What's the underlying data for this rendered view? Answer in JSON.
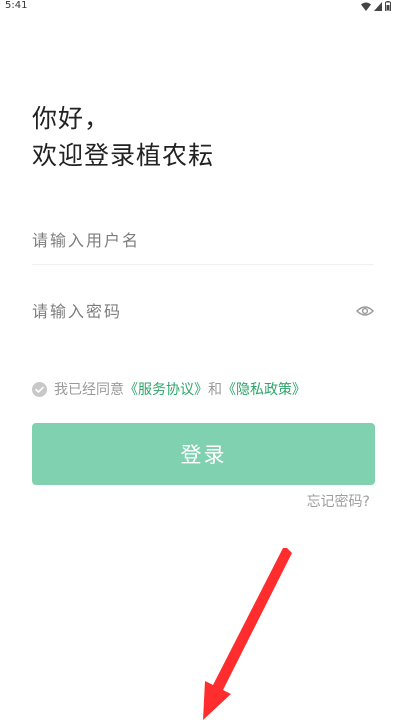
{
  "status_bar": {
    "time": "5:41",
    "icons": [
      "wifi-icon",
      "signal-icon",
      "battery-icon"
    ]
  },
  "greeting": {
    "line1": "你好，",
    "line2": "欢迎登录植农耘"
  },
  "login_form": {
    "username_placeholder": "请输入用户名",
    "username_value": "",
    "password_placeholder": "请输入密码",
    "password_value": "",
    "password_toggle_icon": "eye-icon"
  },
  "agreement": {
    "checked": false,
    "prefix": "我已经同意",
    "service_link": "《服务协议》",
    "connector": "和",
    "privacy_link": "《隐私政策》"
  },
  "login_button_label": "登录",
  "forgot_password_label": "忘记密码?",
  "colors": {
    "accent": "#2fa56a",
    "button": "#80d1b0",
    "annotation_arrow": "#ff2d2d"
  }
}
